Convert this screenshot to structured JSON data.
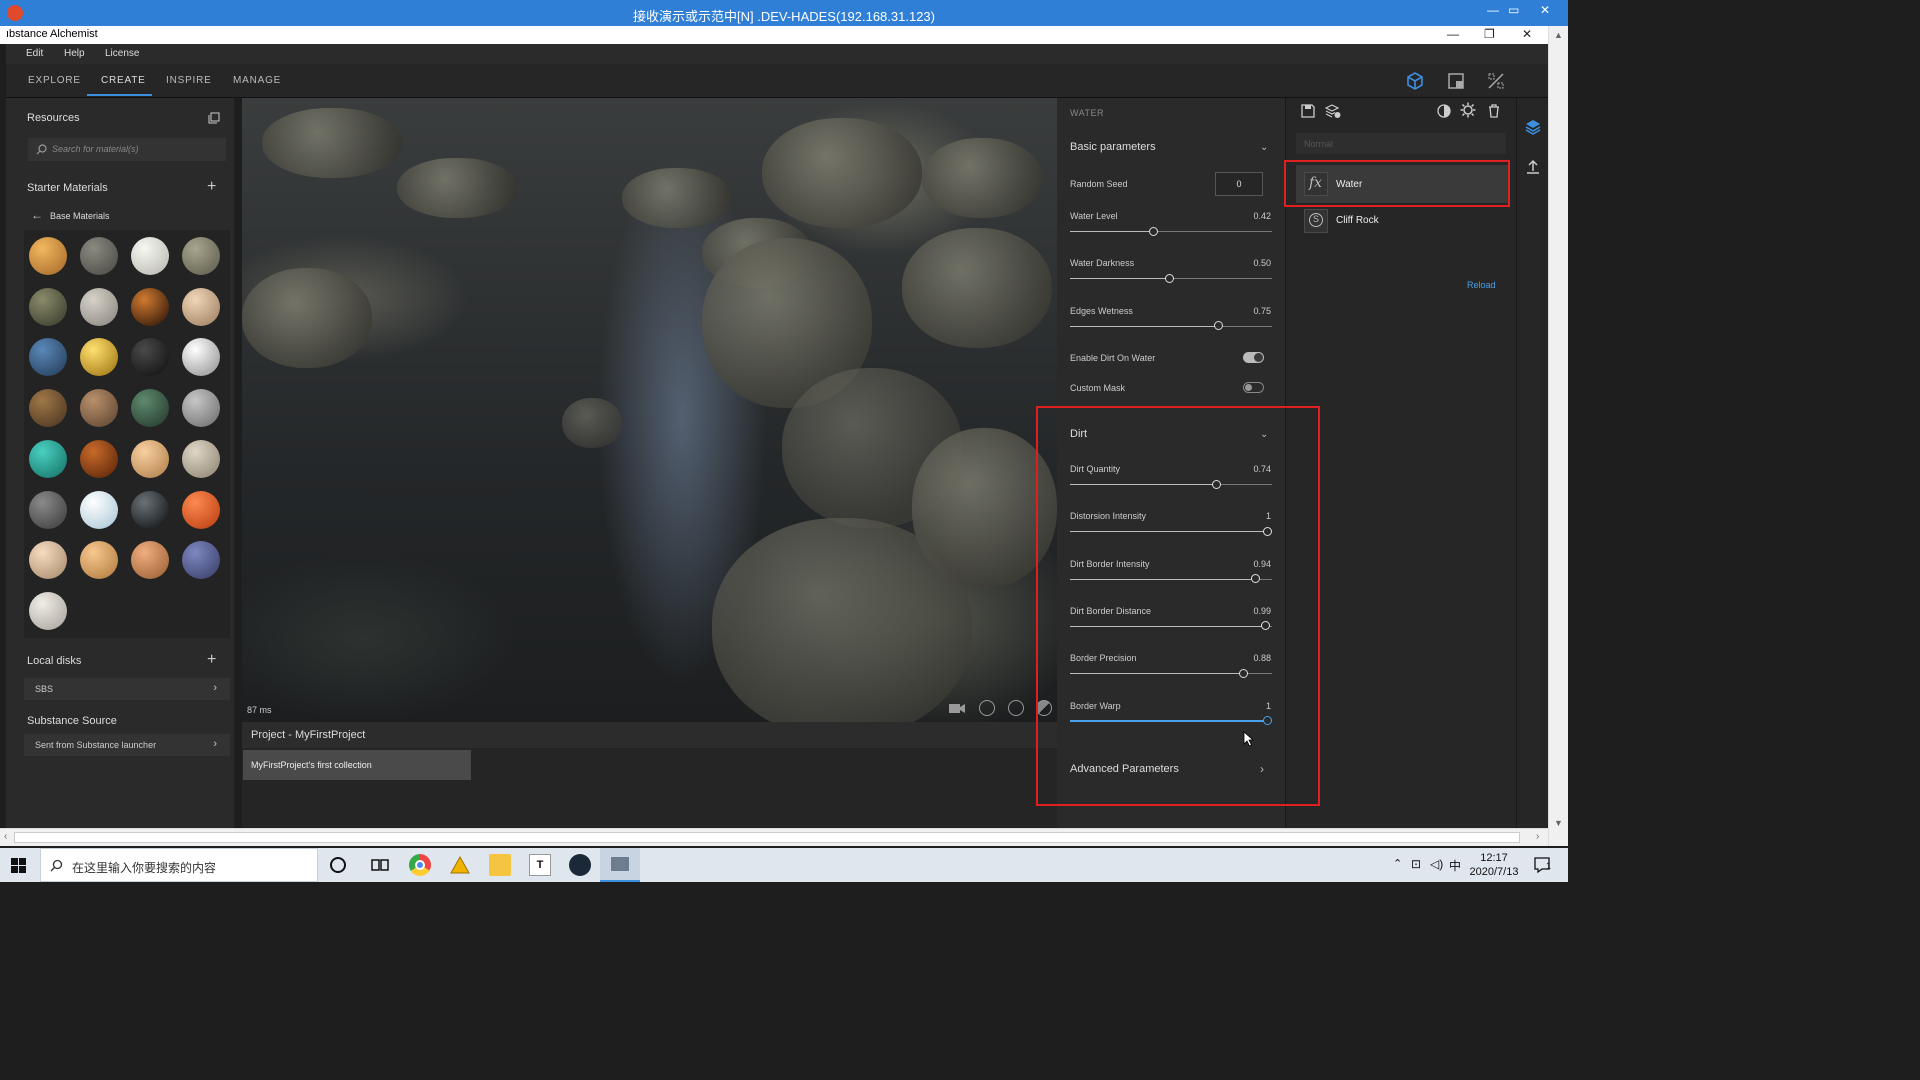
{
  "remote_desktop": {
    "title": "接收演示或示范中[N] .DEV-HADES(192.168.31.123)"
  },
  "app": {
    "title": "ıbstance Alchemist",
    "menu": [
      "Edit",
      "Help",
      "License"
    ],
    "tabs": [
      {
        "label": "EXPLORE",
        "active": false
      },
      {
        "label": "CREATE",
        "active": true
      },
      {
        "label": "INSPIRE",
        "active": false
      },
      {
        "label": "MANAGE",
        "active": false
      }
    ],
    "accent_color": "#3d8fe0"
  },
  "left_panel": {
    "resources_title": "Resources",
    "search_placeholder": "Search for material(s)",
    "starter_title": "Starter Materials",
    "breadcrumb": "Base Materials",
    "material_count": 29,
    "local_disks_title": "Local disks",
    "local_disks_items": [
      "SBS"
    ],
    "source_title": "Substance Source",
    "source_items": [
      "Sent from Substance launcher"
    ]
  },
  "viewport": {
    "render_time": "87 ms",
    "tools": [
      "camera-icon",
      "environment-icon",
      "grid-icon",
      "lighting-icon"
    ]
  },
  "project": {
    "title": "Project - MyFirstProject",
    "collection": "MyFirstProject's first collection"
  },
  "params": {
    "section": "WATER",
    "basic_title": "Basic parameters",
    "random_seed_label": "Random Seed",
    "random_seed_value": "0",
    "basic_sliders": [
      {
        "label": "Water Level",
        "value": "0.42",
        "fraction": 0.42
      },
      {
        "label": "Water Darkness",
        "value": "0.50",
        "fraction": 0.5
      },
      {
        "label": "Edges Wetness",
        "value": "0.75",
        "fraction": 0.75
      }
    ],
    "toggles": [
      {
        "label": "Enable Dirt On Water",
        "on": true
      },
      {
        "label": "Custom Mask",
        "on": false
      }
    ],
    "dirt_title": "Dirt",
    "dirt_sliders": [
      {
        "label": "Dirt Quantity",
        "value": "0.74",
        "fraction": 0.74,
        "active": false
      },
      {
        "label": "Distorsion Intensity",
        "value": "1",
        "fraction": 1.0,
        "active": false
      },
      {
        "label": "Dirt Border Intensity",
        "value": "0.94",
        "fraction": 0.94,
        "active": false
      },
      {
        "label": "Dirt Border Distance",
        "value": "0.99",
        "fraction": 0.99,
        "active": false
      },
      {
        "label": "Border Precision",
        "value": "0.88",
        "fraction": 0.88,
        "active": false
      },
      {
        "label": "Border Warp",
        "value": "1",
        "fraction": 1.0,
        "active": true
      }
    ],
    "advanced_title": "Advanced Parameters"
  },
  "layers": {
    "blend_mode": "Normal",
    "items": [
      {
        "name": "Water",
        "icon": "fx-icon",
        "selected": true
      },
      {
        "name": "Cliff Rock",
        "icon": "substance-icon",
        "selected": false
      }
    ],
    "reload_label": "Reload"
  },
  "taskbar": {
    "search_placeholder": "在这里输入你要搜索的内容",
    "ime": "中",
    "time": "12:17",
    "date": "2020/7/13",
    "notifications": "1"
  }
}
